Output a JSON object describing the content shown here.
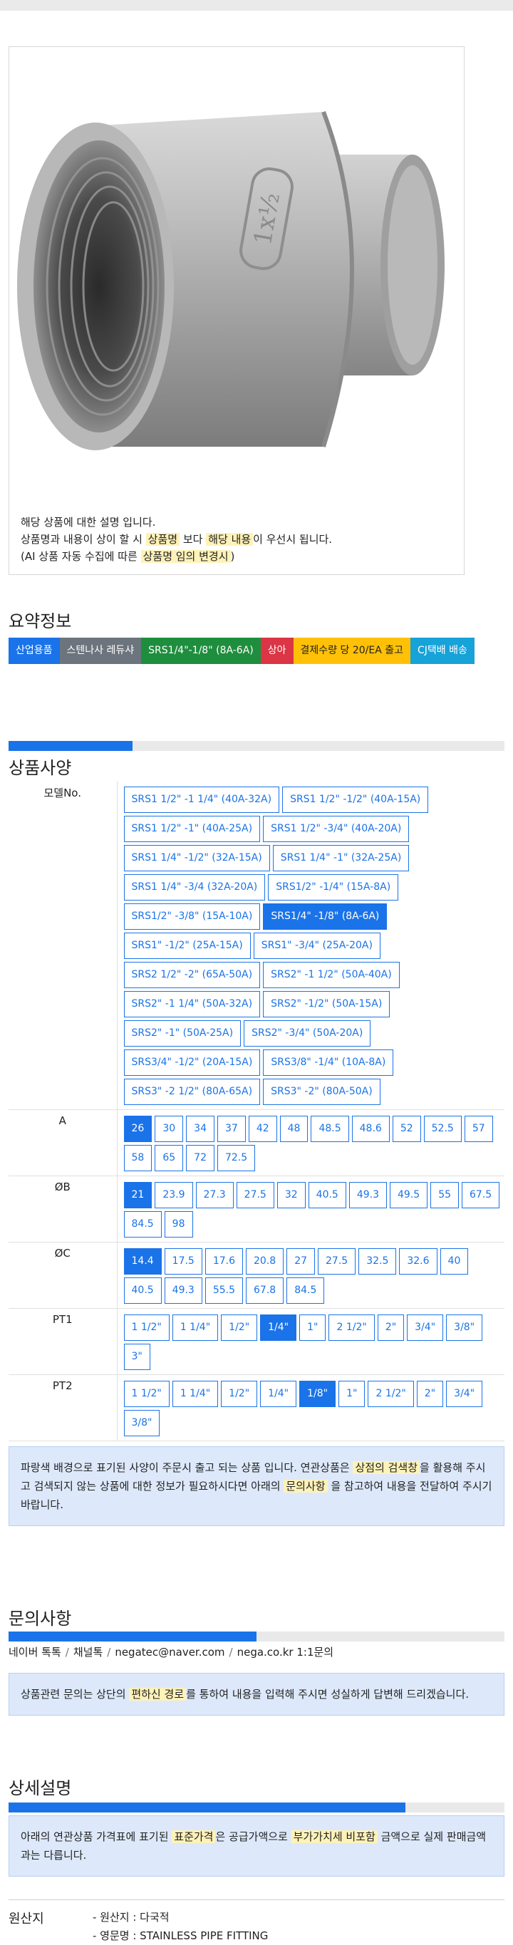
{
  "photo": {
    "image_alt": "Stainless reducing socket fitting",
    "stamp": "1x½",
    "notes": {
      "line1": "해당 상품에 대한 설명 입니다.",
      "line2_pre": "상품명과 내용이 상이 할 시 ",
      "line2_hl1": "상품명",
      "line2_mid": " 보다 ",
      "line2_hl2": "해당 내용",
      "line2_post": "이 우선시 됩니다.",
      "line3_pre": "(AI 상품 자동 수집에 따른 ",
      "line3_hl": "상품명 임의 변경시",
      "line3_post": ")"
    }
  },
  "summary": {
    "title": "요약정보",
    "tags": [
      {
        "label": "산업용품",
        "color": "#1a73e8"
      },
      {
        "label": "스텐나사 레듀샤",
        "color": "#6c757d"
      },
      {
        "label": "SRS1/4\"-1/8\" (8A-6A)",
        "color": "#1e8e3e"
      },
      {
        "label": "상아",
        "color": "#dc3545"
      },
      {
        "label": "결제수량 당 20/EA 출고",
        "color": "#ffc107",
        "text_color": "#222222"
      },
      {
        "label": "CJ택배 배송",
        "color": "#17a2d8"
      }
    ]
  },
  "spec": {
    "title": "상품사양",
    "progress_fraction": 0.25,
    "rows": [
      {
        "label": "모델No.",
        "options": [
          "SRS1 1/2\" -1 1/4\" (40A-32A)",
          "SRS1 1/2\" -1/2\" (40A-15A)",
          "SRS1 1/2\" -1\" (40A-25A)",
          "SRS1 1/2\" -3/4\" (40A-20A)",
          "SRS1 1/4\" -1/2\" (32A-15A)",
          "SRS1 1/4\" -1\" (32A-25A)",
          "SRS1 1/4\" -3/4 (32A-20A)",
          "SRS1/2\" -1/4\" (15A-8A)",
          "SRS1/2\" -3/8\" (15A-10A)",
          "SRS1/4\" -1/8\" (8A-6A)",
          "SRS1\" -1/2\" (25A-15A)",
          "SRS1\" -3/4\" (25A-20A)",
          "SRS2 1/2\" -2\" (65A-50A)",
          "SRS2\" -1 1/2\" (50A-40A)",
          "SRS2\" -1 1/4\" (50A-32A)",
          "SRS2\" -1/2\" (50A-15A)",
          "SRS2\" -1\" (50A-25A)",
          "SRS2\" -3/4\" (50A-20A)",
          "SRS3/4\" -1/2\" (20A-15A)",
          "SRS3/8\" -1/4\" (10A-8A)",
          "SRS3\" -2 1/2\" (80A-65A)",
          "SRS3\" -2\" (80A-50A)"
        ],
        "selected": 9
      },
      {
        "label": "A",
        "options": [
          "26",
          "30",
          "34",
          "37",
          "42",
          "48",
          "48.5",
          "48.6",
          "52",
          "52.5",
          "57",
          "58",
          "65",
          "72",
          "72.5"
        ],
        "selected": 0
      },
      {
        "label": "ØB",
        "options": [
          "21",
          "23.9",
          "27.3",
          "27.5",
          "32",
          "40.5",
          "49.3",
          "49.5",
          "55",
          "67.5",
          "84.5",
          "98"
        ],
        "selected": 0
      },
      {
        "label": "ØC",
        "options": [
          "14.4",
          "17.5",
          "17.6",
          "20.8",
          "27",
          "27.5",
          "32.5",
          "32.6",
          "40",
          "40.5",
          "49.3",
          "55.5",
          "67.8",
          "84.5"
        ],
        "selected": 0
      },
      {
        "label": "PT1",
        "options": [
          "1 1/2\"",
          "1 1/4\"",
          "1/2\"",
          "1/4\"",
          "1\"",
          "2 1/2\"",
          "2\"",
          "3/4\"",
          "3/8\"",
          "3\""
        ],
        "selected": 3
      },
      {
        "label": "PT2",
        "options": [
          "1 1/2\"",
          "1 1/4\"",
          "1/2\"",
          "1/4\"",
          "1/8\"",
          "1\"",
          "2 1/2\"",
          "2\"",
          "3/4\"",
          "3/8\""
        ],
        "selected": 4
      }
    ],
    "notice": {
      "pre": "파랑색 배경으로 표기된 사양이 주문시 출고 되는 상품 입니다. 연관상품은 ",
      "hl1": "상점의 검색창",
      "mid": "을 활용해 주시고 검색되지 않는 상품에 대한 정보가 필요하시다면 아래의 ",
      "hl2": "문의사항",
      "post": " 을 참고하여 내용을 전달하여 주시기 바랍니다."
    }
  },
  "inquiry": {
    "title": "문의사항",
    "progress_fraction": 0.5,
    "contacts": [
      "네이버 톡톡",
      "채널톡",
      "negatec@naver.com",
      "nega.co.kr 1:1문의"
    ],
    "notice": {
      "pre": "상품관련 문의는 상단의 ",
      "hl": "편하신 경로",
      "post": "를 통하여 내용을 입력해 주시면 성실하게 답변해 드리겠습니다."
    }
  },
  "detail": {
    "title": "상세설명",
    "progress_fraction": 0.8,
    "notice": {
      "pre": "아래의 연관상품 가격표에 표기된 ",
      "hl1": "표준가격",
      "mid": "은 공급가액으로 ",
      "hl2": "부가가치세 비포함",
      "post": " 금액으로 실제 판매금액과는 다릅니다."
    }
  },
  "origin": {
    "label": "원산지",
    "lines": [
      "- 원산지 : 다국적",
      "- 영문명 : STAINLESS PIPE FITTING"
    ]
  }
}
